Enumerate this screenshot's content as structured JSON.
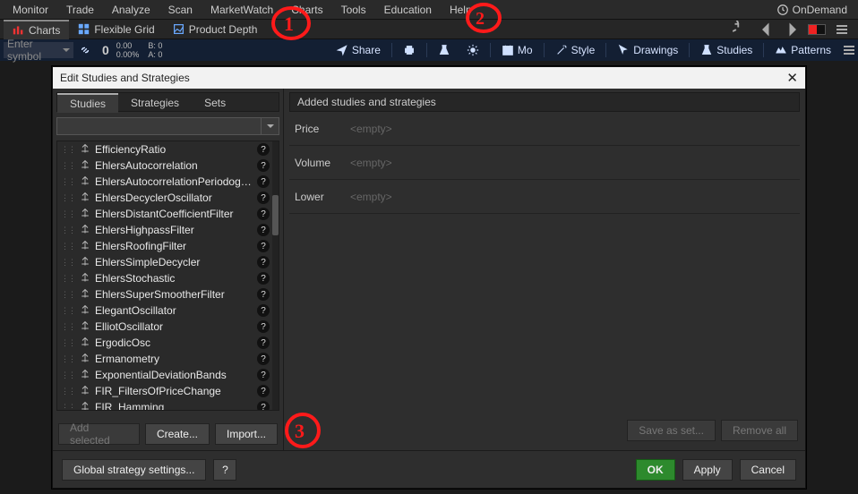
{
  "menubar": {
    "items": [
      "Monitor",
      "Trade",
      "Analyze",
      "Scan",
      "MarketWatch",
      "Charts",
      "Tools",
      "Education",
      "Help"
    ],
    "ondemand_label": "OnDemand"
  },
  "subtabs": {
    "items": [
      {
        "label": "Charts",
        "active": true,
        "icon": "bars-red"
      },
      {
        "label": "Flexible Grid",
        "active": false,
        "icon": "grid"
      },
      {
        "label": "Product Depth",
        "active": false,
        "icon": "depth"
      }
    ]
  },
  "toolbar": {
    "symbol_placeholder": "Enter symbol",
    "big": "0",
    "pct_top": "0.00",
    "pct_bot": "0.00%",
    "ba_top": "B: 0",
    "ba_bot": "A: 0",
    "share": "Share",
    "mo": "Mo",
    "style": "Style",
    "drawings": "Drawings",
    "studies": "Studies",
    "patterns": "Patterns"
  },
  "modal": {
    "title": "Edit Studies and Strategies",
    "left_tabs": [
      "Studies",
      "Strategies",
      "Sets"
    ],
    "studies": [
      "EfficiencyRatio",
      "EhlersAutocorrelation",
      "EhlersAutocorrelationPeriodogr...",
      "EhlersDecyclerOscillator",
      "EhlersDistantCoefficientFilter",
      "EhlersHighpassFilter",
      "EhlersRoofingFilter",
      "EhlersSimpleDecycler",
      "EhlersStochastic",
      "EhlersSuperSmootherFilter",
      "ElegantOscillator",
      "ElliotOscillator",
      "ErgodicOsc",
      "Ermanometry",
      "ExponentialDeviationBands",
      "FIR_FiltersOfPriceChange",
      "FIR_Hamming"
    ],
    "add_selected": "Add selected",
    "create": "Create...",
    "import": "Import...",
    "rp_title": "Added studies and strategies",
    "slots": [
      {
        "label": "Price",
        "value": "<empty>"
      },
      {
        "label": "Volume",
        "value": "<empty>"
      },
      {
        "label": "Lower",
        "value": "<empty>"
      }
    ],
    "save_as_set": "Save as set...",
    "remove_all": "Remove all",
    "global": "Global strategy settings...",
    "ok": "OK",
    "apply": "Apply",
    "cancel": "Cancel"
  }
}
